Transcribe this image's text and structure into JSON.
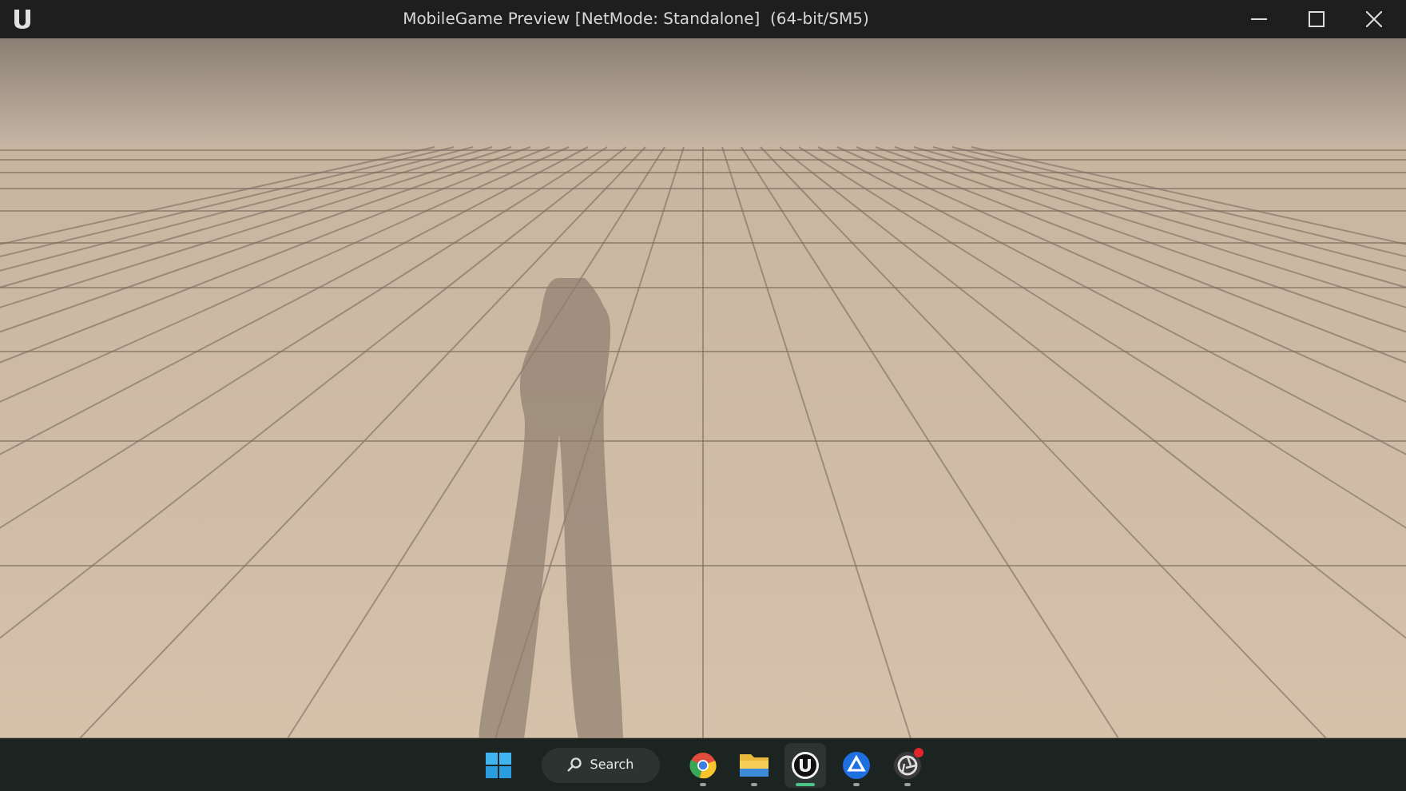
{
  "window": {
    "title": "MobileGame Preview [NetMode: Standalone]  (64-bit/SM5)"
  },
  "taskbar": {
    "search": {
      "placeholder": "Search"
    },
    "apps": [
      {
        "kind": "start",
        "selected": false,
        "running": false,
        "notification": false
      },
      {
        "kind": "search",
        "selected": false,
        "running": false,
        "notification": false
      },
      {
        "kind": "browser",
        "selected": false,
        "running": true,
        "notification": false
      },
      {
        "kind": "files",
        "selected": false,
        "running": true,
        "notification": false
      },
      {
        "kind": "engine",
        "selected": true,
        "running": true,
        "notification": false
      },
      {
        "kind": "share",
        "selected": false,
        "running": true,
        "notification": false
      },
      {
        "kind": "camera",
        "selected": false,
        "running": true,
        "notification": true
      }
    ]
  }
}
